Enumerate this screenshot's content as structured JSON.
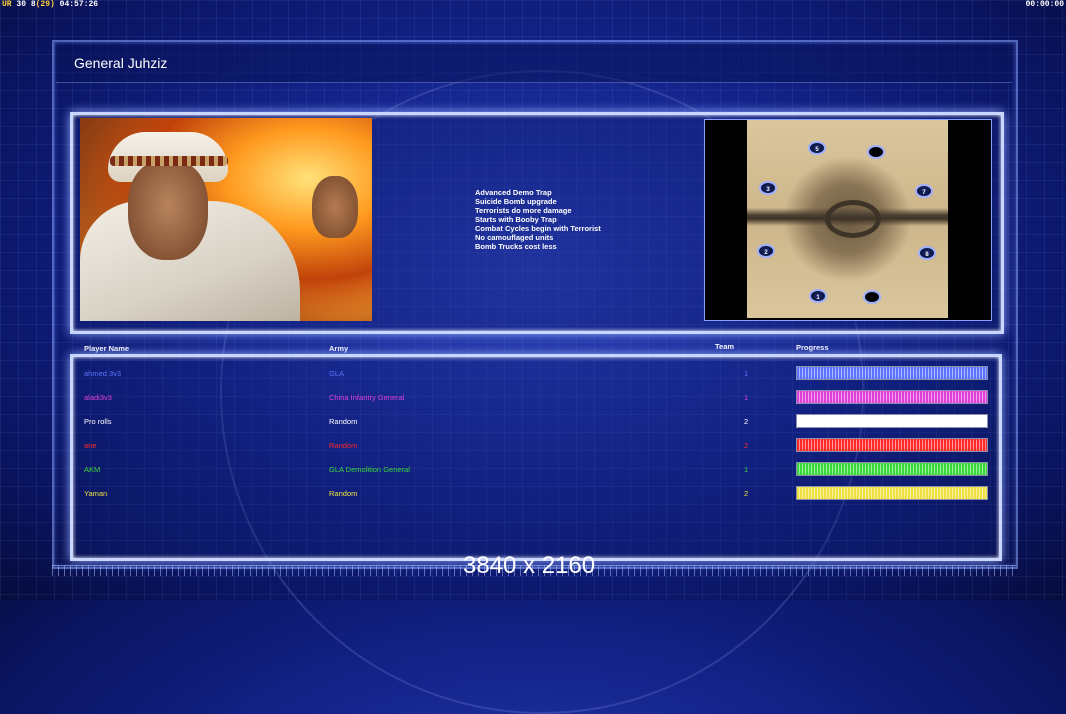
{
  "hud": {
    "ur": "UR",
    "stats": "30 8",
    "bracket": "(29)",
    "clock_left": "04:57:26",
    "clock_right": "00:00:00"
  },
  "title": "General Juhziz",
  "traits": [
    "Advanced Demo Trap",
    "Suicide Bomb upgrade",
    "Terrorists do more damage",
    "Starts with Booby Trap",
    "Combat Cycles begin with Terrorist",
    "No camouflaged units",
    "Bomb Trucks cost less"
  ],
  "map": {
    "starts": [
      {
        "label": "5"
      },
      {
        "label": ""
      },
      {
        "label": "3"
      },
      {
        "label": "7"
      },
      {
        "label": "2"
      },
      {
        "label": "8"
      },
      {
        "label": "1"
      },
      {
        "label": ""
      }
    ]
  },
  "columns": {
    "player": "Player Name",
    "army": "Army",
    "team": "Team",
    "progress": "Progress"
  },
  "players": [
    {
      "name": "ahmed 3v3",
      "army": "GLA",
      "team": "1",
      "color": "#5a72ff",
      "progress": 1.0
    },
    {
      "name": "aladi3v3",
      "army": "China Infantry General",
      "team": "1",
      "color": "#e040d8",
      "progress": 1.0
    },
    {
      "name": "Pro rolls",
      "army": "Random",
      "team": "2",
      "color": "#ffffff",
      "progress": 1.0
    },
    {
      "name": "ane",
      "army": "Random",
      "team": "2",
      "color": "#ff2a2a",
      "progress": 1.0
    },
    {
      "name": "AKM",
      "army": "GLA Demolition General",
      "team": "1",
      "color": "#3ad83a",
      "progress": 1.0
    },
    {
      "name": "Yaman",
      "army": "Random",
      "team": "2",
      "color": "#f0e040",
      "progress": 1.0
    }
  ],
  "watermark": "3840 x 2160"
}
